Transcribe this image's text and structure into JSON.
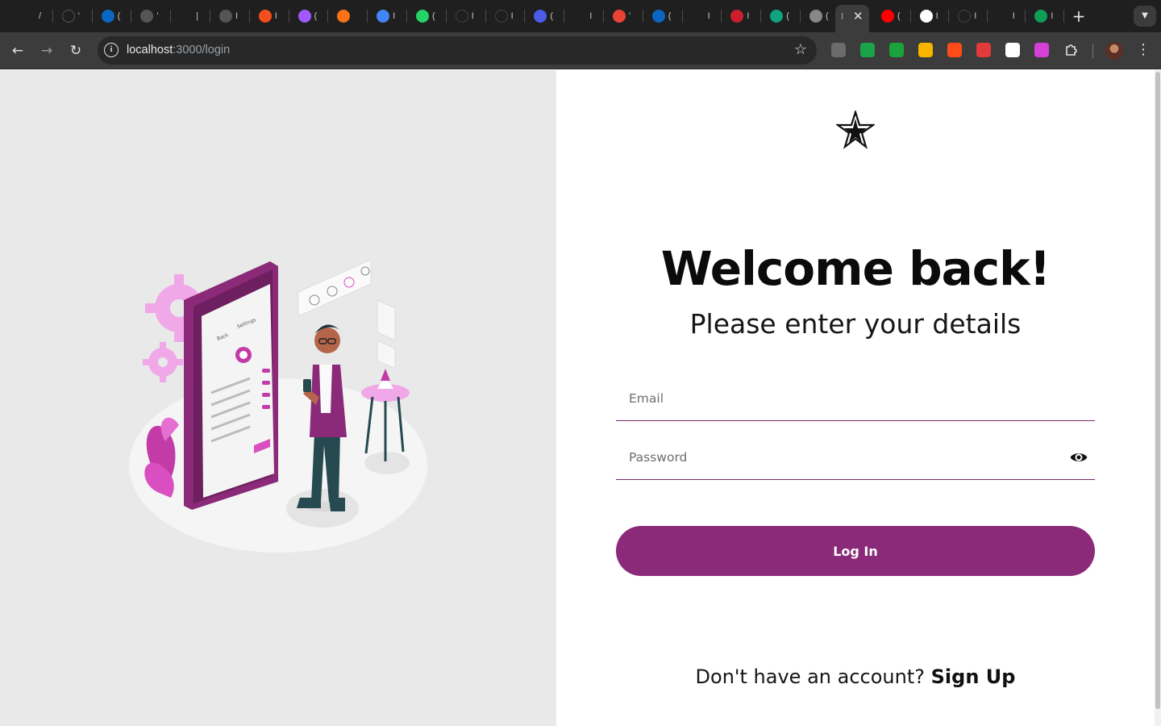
{
  "browser": {
    "tabs": [
      {
        "icon": "T",
        "char": "/",
        "color": "#1f1f1f"
      },
      {
        "icon": "github-icon",
        "char": "'",
        "color": "#555"
      },
      {
        "icon": "in",
        "char": "(",
        "color": "#0a66c2"
      },
      {
        "icon": "g",
        "char": "'",
        "color": "#555"
      },
      {
        "icon": "o",
        "char": "|",
        "color": "#1f1f1f"
      },
      {
        "icon": "o",
        "char": "I",
        "color": "#555"
      },
      {
        "icon": "figma",
        "char": "I",
        "color": "#f24e1e"
      },
      {
        "icon": "figma",
        "char": "(",
        "color": "#a259ff"
      },
      {
        "icon": "o",
        "char": "",
        "color": "#f97316"
      },
      {
        "icon": "docs",
        "char": "I",
        "color": "#4285f4"
      },
      {
        "icon": "wa",
        "char": "(",
        "color": "#25d366"
      },
      {
        "icon": "github-icon",
        "char": "I",
        "color": "#444"
      },
      {
        "icon": "github-icon",
        "char": "I",
        "color": "#444"
      },
      {
        "icon": "e",
        "char": "(",
        "color": "#4b5de6"
      },
      {
        "icon": "o",
        "char": "I",
        "color": "#1f1f1f"
      },
      {
        "icon": "M",
        "char": "'",
        "color": "#ea4335"
      },
      {
        "icon": "in",
        "char": "(",
        "color": "#0a66c2"
      },
      {
        "icon": "a",
        "char": "I",
        "color": "#1f1f1f"
      },
      {
        "icon": "n",
        "char": "I",
        "color": "#cc1f2e"
      },
      {
        "icon": "c",
        "char": "(",
        "color": "#10a37f"
      },
      {
        "icon": "c",
        "char": "(",
        "color": "#888"
      }
    ],
    "active_tab_char": "(",
    "tabs_after": [
      {
        "icon": "yt",
        "char": "(",
        "color": "#ff0000"
      },
      {
        "icon": "G",
        "char": "I",
        "color": "#ffffff"
      },
      {
        "icon": "github-icon",
        "char": "I",
        "color": "#444"
      },
      {
        "icon": "star",
        "char": "I",
        "color": "#1f1f1f"
      },
      {
        "icon": "drive",
        "char": "I",
        "color": "#0f9d58"
      }
    ],
    "url_host": "localhost",
    "url_path": ":3000/login",
    "extensions": [
      "#6b6b6b",
      "#19a34a",
      "#1aa33a",
      "#f7b500",
      "#ff4a1a",
      "#e23a3a",
      "#ffffff",
      "#d63fd8"
    ]
  },
  "login": {
    "title": "Welcome back!",
    "subtitle": "Please enter your details",
    "email_placeholder": "Email",
    "password_placeholder": "Password",
    "login_button": "Log In",
    "signup_prompt": "Don't have an account?",
    "signup_link": "Sign Up"
  },
  "colors": {
    "accent": "#8a2a78",
    "left_panel_bg": "#e9e9e9"
  }
}
